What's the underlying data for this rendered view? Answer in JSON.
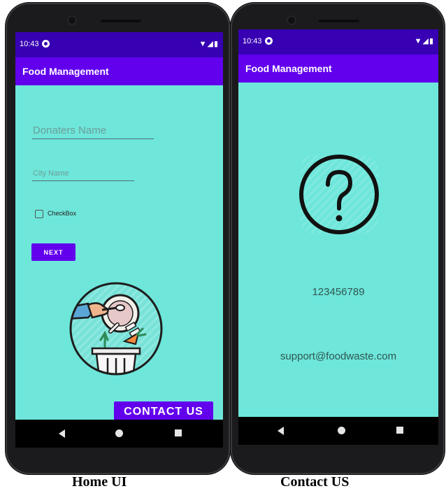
{
  "home": {
    "status": {
      "time": "10:43",
      "system_icons": "▼◢▮"
    },
    "appbar_title": "Food Management",
    "donor_field": {
      "placeholder": "Donaters Name"
    },
    "city_field": {
      "placeholder": "City Name"
    },
    "checkbox_label": "CheckBox",
    "next_label": "NEXT",
    "contact_label": "CONTACT US",
    "illustration_icon": "food-waste-illustration"
  },
  "contact": {
    "status": {
      "time": "10:43",
      "system_icons": "▼◢▮"
    },
    "appbar_title": "Food Management",
    "help_icon": "question-circle-icon",
    "phone": "123456789",
    "email": "support@foodwaste.com"
  },
  "captions": {
    "left": "Home UI",
    "right": "Contact US"
  },
  "colors": {
    "status_bar": "#3700b3",
    "app_bar": "#6200ee",
    "screen_bg": "#6ee6da",
    "button": "#6200ee"
  }
}
